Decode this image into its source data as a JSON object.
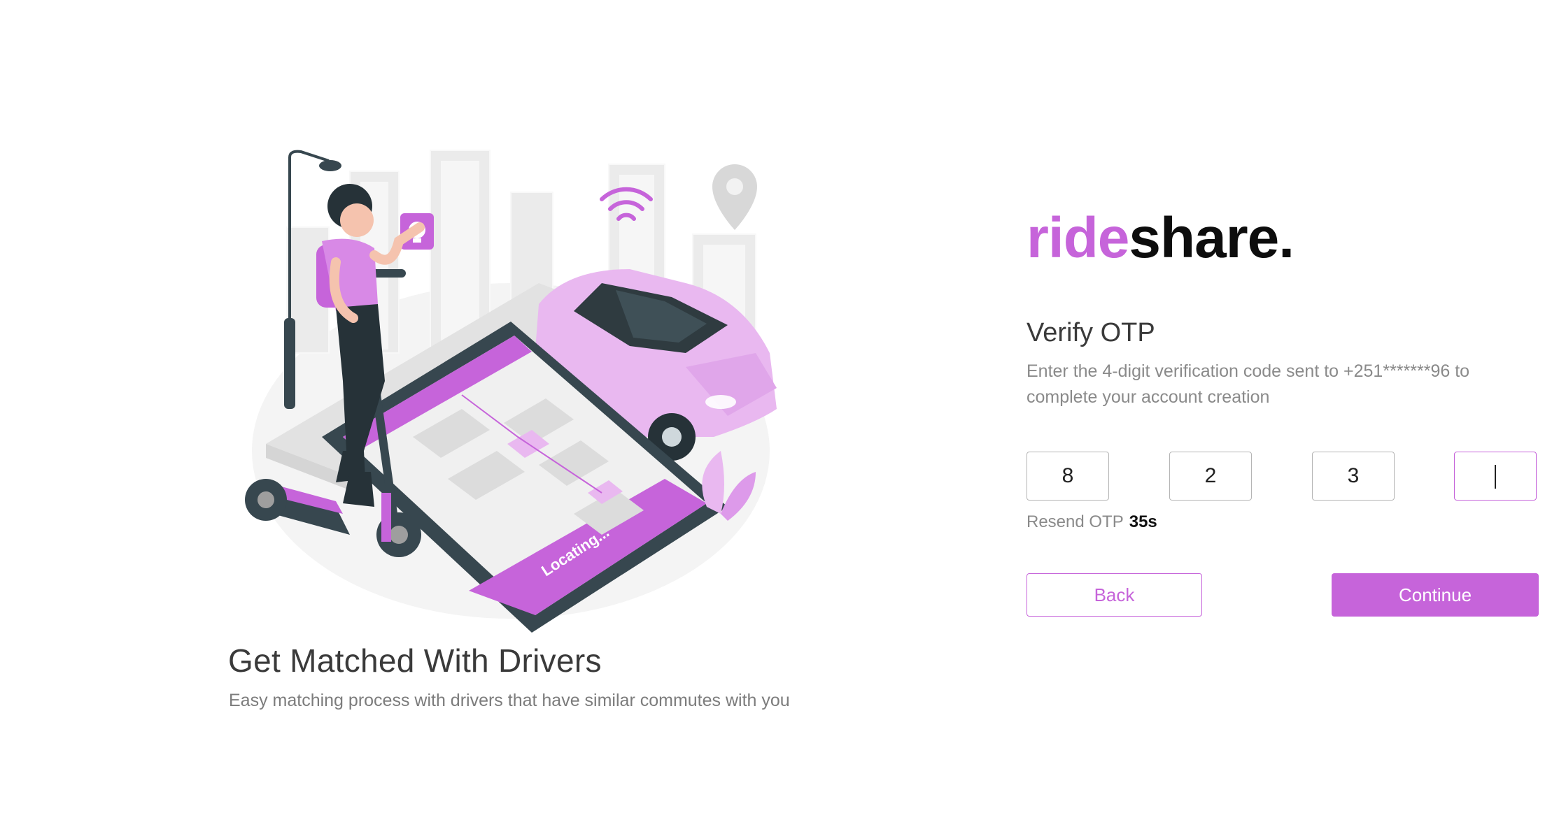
{
  "brand": {
    "accent_part": "ride",
    "dark_part": "share.",
    "accent_color": "#c664da"
  },
  "onboarding": {
    "title": "Get Matched With Drivers",
    "subtitle": "Easy matching process with drivers that have similar commutes with you",
    "screen_label": "Locating..."
  },
  "otp": {
    "title": "Verify OTP",
    "description": "Enter the 4-digit verification code sent to +251*******96 to complete your account creation",
    "digits": [
      "8",
      "2",
      "3",
      ""
    ],
    "resend_label": "Resend OTP",
    "resend_timer": "35s"
  },
  "actions": {
    "back_label": "Back",
    "continue_label": "Continue"
  }
}
